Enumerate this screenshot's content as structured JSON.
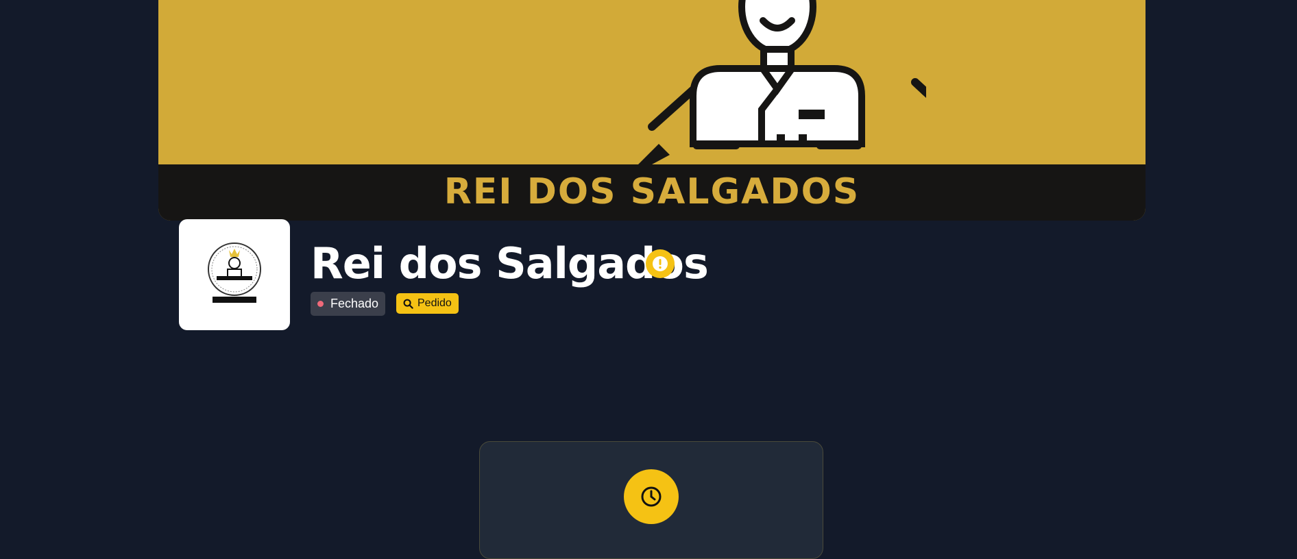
{
  "banner": {
    "text": "REI DOS SALGADOS",
    "background": "#d2aa38",
    "strip_color": "#161514",
    "text_color": "#d7ac3c"
  },
  "store": {
    "name": "Rei dos Salgados",
    "status": "Fechado",
    "status_dot_color": "#f06a7a",
    "order_button": "Pedido",
    "order_icon": "search-icon",
    "warning_icon": "exclamation-icon"
  },
  "notice": {
    "icon": "clock-icon",
    "accent": "#f5c214"
  },
  "colors": {
    "background": "#131a2a",
    "accent": "#f5c214"
  }
}
